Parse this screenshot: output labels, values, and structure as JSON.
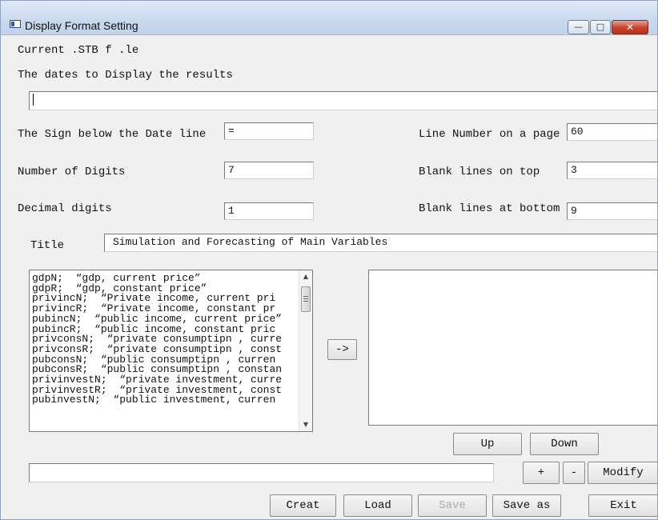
{
  "window": {
    "title": "Display Format Setting",
    "controls": {
      "minimize": "—",
      "maximize": "□",
      "close": "✕"
    }
  },
  "current_file_label": "Current .STB f .le",
  "dates_label": "The dates to Display the results",
  "dates_value": "",
  "fields": {
    "sign_label": "The Sign below the Date line",
    "sign_value": "=",
    "digits_label": "Number of Digits",
    "digits_value": "7",
    "decimal_label": "Decimal digits",
    "decimal_value": "1",
    "line_number_label": "Line Number on a page",
    "line_number_value": "60",
    "blank_top_label": "Blank lines on top",
    "blank_top_value": "3",
    "blank_bottom_label": "Blank lines at bottom",
    "blank_bottom_value": "9",
    "title_label": "Title",
    "title_value": "Simulation and Forecasting of Main Variables"
  },
  "variables": [
    "gdpN;  “gdp, current price”",
    "gdpR;  “gdp, constant price”",
    "privincN;  “Private income, current pri",
    "privincR;  “Private income, constant pr",
    "pubincN;  “public income, current price”",
    "pubincR;  “public income, constant pric",
    "privconsN;  “private consumptipn , curre",
    "privconsR;  “private consumptipn , const",
    "pubconsN;  “public consumptipn , curren",
    "pubconsR;  “public consumptipn , constan",
    "privinvestN;  “private investment, curre",
    "privinvestR;  “private investment, const",
    "pubinvestN;  “public investment, curren"
  ],
  "buttons": {
    "transfer": "->",
    "up": "Up",
    "down": "Down",
    "plus": "+",
    "minus": "-",
    "modify": "Modify",
    "creat": "Creat",
    "load": "Load",
    "save": "Save",
    "save_as": "Save as",
    "exit": "Exit"
  },
  "edit_value": "",
  "icons": {
    "scroll_up": "scroll-up-arrow-icon",
    "scroll_down": "scroll-down-arrow-icon",
    "scroll_up_glyph": "▲",
    "scroll_down_glyph": "▼"
  }
}
